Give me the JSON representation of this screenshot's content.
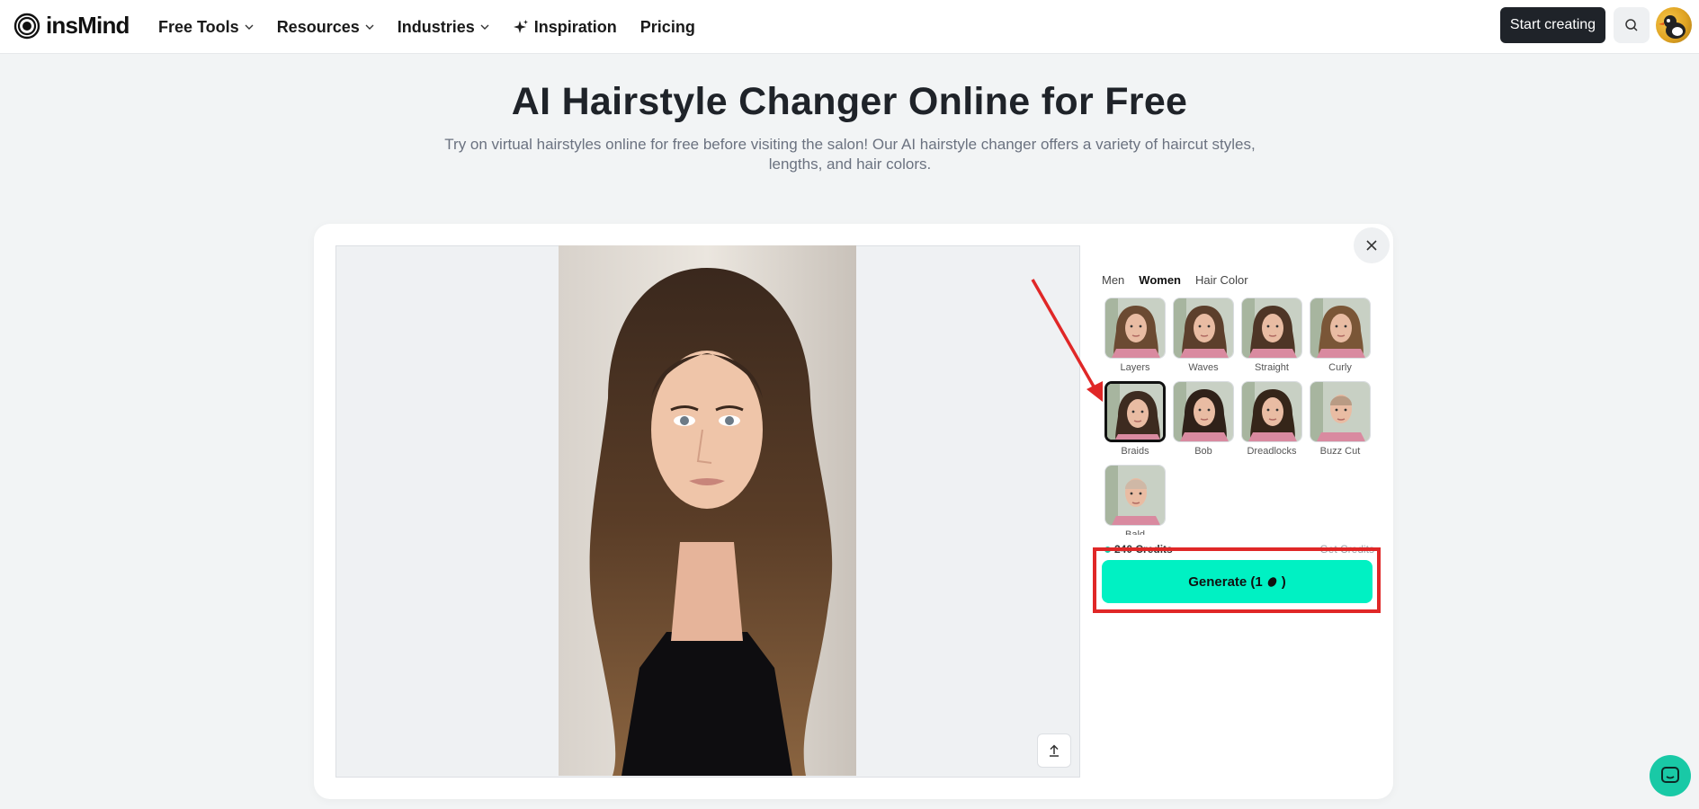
{
  "brand": {
    "name": "insMind"
  },
  "nav": {
    "items": [
      {
        "label": "Free Tools"
      },
      {
        "label": "Resources"
      },
      {
        "label": "Industries"
      },
      {
        "label": "Inspiration"
      },
      {
        "label": "Pricing"
      }
    ],
    "start_label": "Start creating"
  },
  "hero": {
    "title": "AI Hairstyle Changer Online for Free",
    "subtitle": "Try on virtual hairstyles online for free before visiting the salon! Our AI hairstyle changer offers a variety of haircut styles, lengths, and hair colors."
  },
  "panel": {
    "tabs": [
      {
        "label": "Men",
        "active": false
      },
      {
        "label": "Women",
        "active": true
      },
      {
        "label": "Hair Color",
        "active": false
      }
    ],
    "styles": [
      {
        "label": "Layers"
      },
      {
        "label": "Waves"
      },
      {
        "label": "Straight"
      },
      {
        "label": "Curly"
      },
      {
        "label": "Braids",
        "selected": true
      },
      {
        "label": "Bob"
      },
      {
        "label": "Dreadlocks"
      },
      {
        "label": "Buzz Cut"
      },
      {
        "label": "Bald"
      }
    ],
    "credits": "240 Credits",
    "get_credits": "Get Credits",
    "generate_label": "Generate (1",
    "generate_suffix": ")"
  },
  "colors": {
    "accent": "#00f1c3",
    "highlight": "#e02727",
    "dark_button": "#1f2329",
    "chat": "#19c9a6"
  }
}
